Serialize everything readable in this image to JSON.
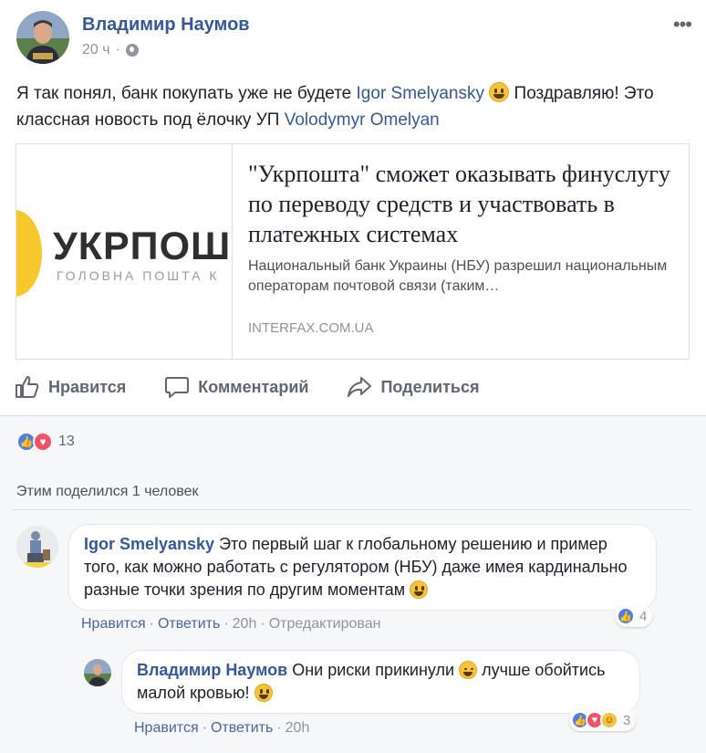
{
  "post": {
    "author": "Владимир Наумов",
    "time": "20 ч",
    "more": "•••",
    "text_part1": "Я так понял, банк покупать уже не будете ",
    "mention1": "Igor Smelyansky",
    "text_part2": " Поздравляю! Это классная новость под ёлочку УП ",
    "mention2": "Volodymyr Omelyan"
  },
  "link": {
    "thumb_word": "УКРПОШ",
    "thumb_sub": "ГОЛОВНА ПОШТА К",
    "title": "\"Укрпошта\" сможет оказывать финуслугу по переводу средств и участвовать в платежных системах",
    "description": "Национальный банк Украины (НБУ) разрешил национальным операторам почтовой связи (таким…",
    "domain": "INTERFAX.COM.UA"
  },
  "actions": {
    "like": "Нравится",
    "comment": "Комментарий",
    "share": "Поделиться"
  },
  "feedback": {
    "reaction_count": "13",
    "shared_by": "Этим поделился 1 человек"
  },
  "comments": [
    {
      "name": "Igor Smelyansky",
      "text": " Это первый шаг к глобальному решению и пример того, как можно работать с регулятором (НБУ) даже имея кардинально разные точки зрения по другим моментам ",
      "like": "Нравится",
      "reply": "Ответить",
      "time": "20h",
      "edited": "Отредактирован",
      "reactions": "4"
    },
    {
      "name": "Владимир Наумов",
      "text_part1": " Они риски прикинули ",
      "text_part2": " лучше обойтись малой кровью! ",
      "like": "Нравится",
      "reply": "Ответить",
      "time": "20h",
      "reactions": "3"
    }
  ],
  "colors": {
    "link_blue": "#365899",
    "meta_gray": "#90949c",
    "like_blue": "#4d7fe8",
    "love_red": "#f25268",
    "feedback_bg": "#f6f7f9"
  },
  "icons": [
    "globe-icon",
    "more-icon",
    "like-icon",
    "comment-icon",
    "share-icon",
    "love-icon",
    "haha-icon"
  ]
}
